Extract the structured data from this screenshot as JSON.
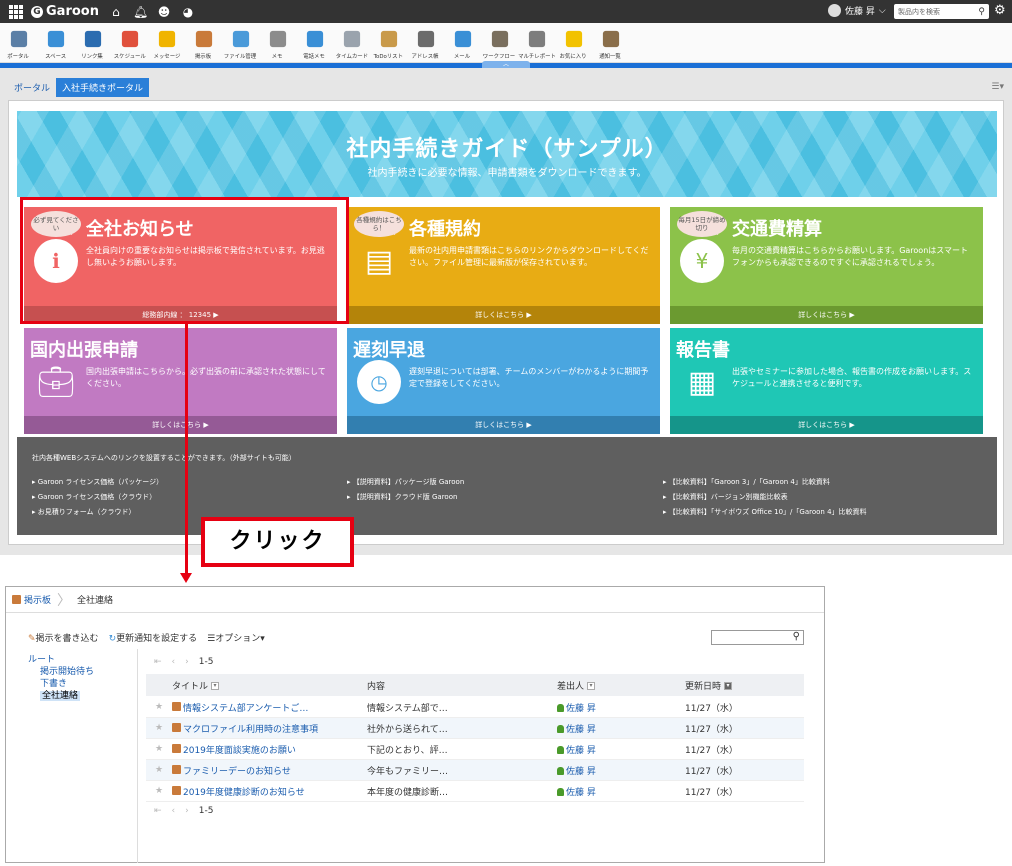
{
  "topbar": {
    "logo": "Garoon",
    "user_name": "佐藤 昇",
    "search_placeholder": "製品内を検索"
  },
  "apps": [
    {
      "label": "ポータル",
      "color": "#5b7fa6"
    },
    {
      "label": "スペース",
      "color": "#3a8fd6"
    },
    {
      "label": "リンク集",
      "color": "#2b6cb0"
    },
    {
      "label": "スケジュール",
      "color": "#e0503c"
    },
    {
      "label": "メッセージ",
      "color": "#f0b400"
    },
    {
      "label": "掲示板",
      "color": "#c97a3a"
    },
    {
      "label": "ファイル管理",
      "color": "#4a9ad9"
    },
    {
      "label": "メモ",
      "color": "#8c8c8c"
    },
    {
      "label": "電話メモ",
      "color": "#3a8fd6"
    },
    {
      "label": "タイムカード",
      "color": "#9aa3ad"
    },
    {
      "label": "ToDoリスト",
      "color": "#c99a4a"
    },
    {
      "label": "アドレス帳",
      "color": "#6b6b6b"
    },
    {
      "label": "メール",
      "color": "#3a8fd6"
    },
    {
      "label": "ワークフロー",
      "color": "#7a6f5e"
    },
    {
      "label": "マルチレポート",
      "color": "#7d7d7d"
    },
    {
      "label": "お気に入り",
      "color": "#f2c200"
    },
    {
      "label": "通知一覧",
      "color": "#8a6e4a"
    }
  ],
  "portal": {
    "tabs": [
      "ポータル",
      "入社手続きポータル"
    ],
    "banner_title": "社内手続きガイド（サンプル）",
    "banner_sub": "社内手続きに必要な情報、申請書類をダウンロードできます。"
  },
  "cards": [
    {
      "title": "全社お知らせ",
      "bubble": "必ず見てください",
      "desc": "全社員向けの重要なお知らせは掲示板で発信されています。お見逃し無いようお願いします。",
      "foot": "総務部内線 ： 12345 ▶",
      "bg": "#f06464",
      "footbg": "#c65050"
    },
    {
      "title": "各種規約",
      "bubble": "各種規約はこちら！",
      "desc": "最新の社内用申請書類はこちらのリンクからダウンロードしてください。ファイル管理に最新版が保存されています。",
      "foot": "詳しくはこちら ▶",
      "bg": "#e8ac14",
      "footbg": "#b4840a"
    },
    {
      "title": "交通費精算",
      "bubble": "毎月15日が締め切り",
      "desc": "毎月の交通費精算はこちらからお願いします。Garoonはスマートフォンからも承認できるのですぐに承認されるでしょう。",
      "foot": "詳しくはこちら ▶",
      "bg": "#8cc24a",
      "footbg": "#6b9a30"
    },
    {
      "title": "国内出張申請",
      "desc": "国内出張申請はこちらから。必ず出張の前に承認された状態にしてください。",
      "foot": "詳しくはこちら ▶",
      "bg": "#c17ac2",
      "footbg": "#955a96"
    },
    {
      "title": "遅刻早退",
      "desc": "遅刻早退については部署、チームのメンバーがわかるように期間予定で登録をしてください。",
      "foot": "詳しくはこちら ▶",
      "bg": "#4aa6e0",
      "footbg": "#327fb0"
    },
    {
      "title": "報告書",
      "desc": "出張やセミナーに参加した場合、報告書の作成をお願いします。スケジュールと連携させると便利です。",
      "foot": "詳しくはこちら ▶",
      "bg": "#1fc7b5",
      "footbg": "#15958a"
    }
  ],
  "links": {
    "header": "社内各種WEBシステムへのリンクを設置することができます。（外部サイトも可能）",
    "col1": [
      "Garoon ライセンス価格（パッケージ）",
      "Garoon ライセンス価格（クラウド）",
      "お見積りフォーム（クラウド）"
    ],
    "col2": [
      "【説明資料】パッケージ版 Garoon",
      "【説明資料】クラウド版 Garoon"
    ],
    "col3": [
      "【比較資料】「Garoon 3」/「Garoon 4」比較資料",
      "【比較資料】バージョン別機能比較表",
      "【比較資料】「サイボウズ Office 10」/「Garoon 4」比較資料"
    ]
  },
  "annotation": {
    "click": "クリック"
  },
  "board": {
    "crumb_app": "掲示板",
    "crumb_category": "全社連絡",
    "tools": [
      "掲示を書き込む",
      "更新通知を設定する",
      "オプション▾"
    ],
    "tree": {
      "root": "ルート",
      "items": [
        "掲示開始待ち",
        "下書き"
      ],
      "selected": "全社連絡"
    },
    "pager": "1-5",
    "columns": [
      "タイトル",
      "内容",
      "差出人",
      "更新日時"
    ],
    "rows": [
      {
        "title": "情報システム部アンケートご…",
        "content": "情報システム部で…",
        "sender": "佐藤 昇",
        "date": "11/27（水）"
      },
      {
        "title": "マクロファイル利用時の注意事項",
        "content": "社外から送られて…",
        "sender": "佐藤 昇",
        "date": "11/27（水）"
      },
      {
        "title": "2019年度面談実施のお願い",
        "content": "下記のとおり、評…",
        "sender": "佐藤 昇",
        "date": "11/27（水）"
      },
      {
        "title": "ファミリーデーのお知らせ",
        "content": "今年もファミリー…",
        "sender": "佐藤 昇",
        "date": "11/27（水）"
      },
      {
        "title": "2019年度健康診断のお知らせ",
        "content": "本年度の健康診断…",
        "sender": "佐藤 昇",
        "date": "11/27（水）"
      }
    ]
  }
}
